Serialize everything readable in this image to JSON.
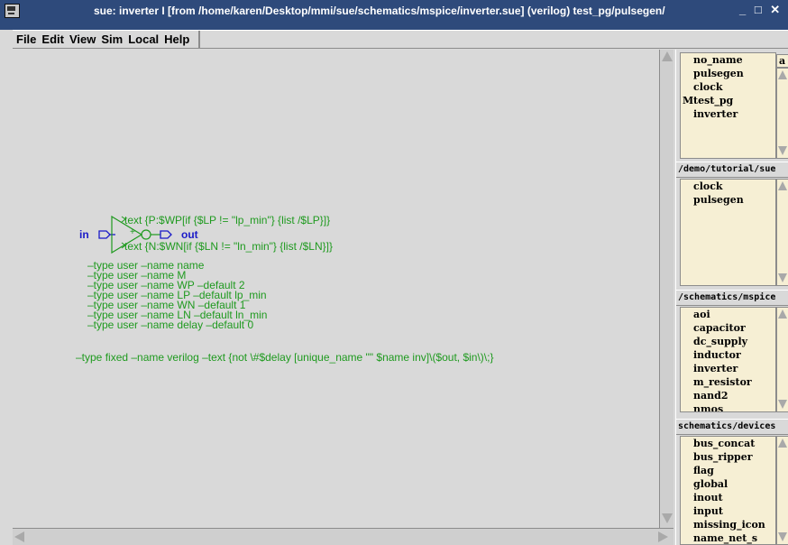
{
  "window": {
    "title": "sue:  inverter I  [from /home/karen/Desktop/mmi/sue/schematics/mspice/inverter.sue]  (verilog)  test_pg/pulsegen/",
    "controls": "_ □ ✕"
  },
  "menu": [
    "File",
    "Edit",
    "View",
    "Sim",
    "Local",
    "Help"
  ],
  "schematic": {
    "pin_in": "in",
    "pin_out": "out",
    "plus_sign": "+",
    "text_p": "text {P:$WP[if {$LP != \"lp_min\"} {list /$LP}]}",
    "text_n": "text {N:$WN[if {$LN != \"ln_min\"} {list /$LN}]}",
    "params": [
      "–type user –name name",
      "–type user –name M",
      "–type user –name WP –default 2",
      "–type user –name LP –default lp_min",
      "–type user –name WN –default 1",
      "–type user –name LN –default ln_min",
      "–type user –name delay –default 0"
    ],
    "verilog_line": "–type fixed –name verilog –text {not \\#$delay [unique_name \"\" $name inv]\\($out, $in\\)\\;}"
  },
  "panel": {
    "top_box_char": "a",
    "hierarchy": {
      "items": [
        "no_name",
        "pulsegen",
        "clock",
        "test_pg",
        "inverter"
      ],
      "marked_index": 3,
      "marker": "M"
    },
    "libs": [
      {
        "header": "/demo/tutorial/sue",
        "items": [
          "clock",
          "pulsegen"
        ]
      },
      {
        "header": "/schematics/mspice",
        "items": [
          "aoi",
          "capacitor",
          "dc_supply",
          "inductor",
          "inverter",
          "m_resistor",
          "nand2",
          "nmos"
        ]
      },
      {
        "header": "schematics/devices",
        "items": [
          "bus_concat",
          "bus_ripper",
          "flag",
          "global",
          "inout",
          "input",
          "missing_icon",
          "name_net_s"
        ]
      }
    ]
  },
  "colors": {
    "title_bg": "#2e4a7b",
    "canvas_bg": "#d9d9d9",
    "schematic_green": "#1f9a1f",
    "pin_blue": "#1a1ac8",
    "list_bg": "#f6efd4"
  }
}
